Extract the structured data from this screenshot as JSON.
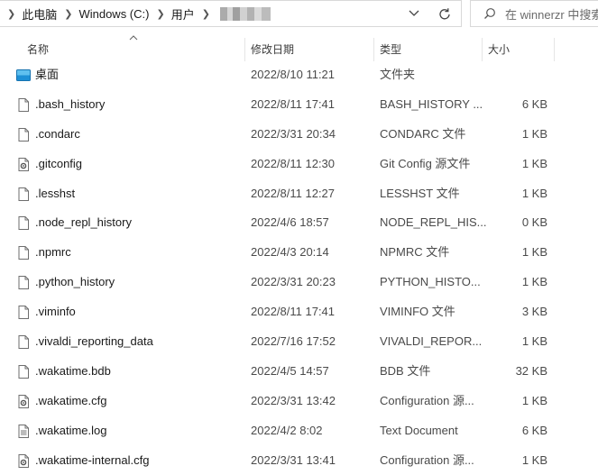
{
  "address": {
    "crumbs": [
      "此电脑",
      "Windows (C:)",
      "用户"
    ]
  },
  "search": {
    "placeholder": "在 winnerzr 中搜索"
  },
  "columns": {
    "name": "名称",
    "date": "修改日期",
    "type": "类型",
    "size": "大小"
  },
  "files": [
    {
      "name": "桌面",
      "date": "2022/8/10 11:21",
      "type": "文件夹",
      "size": "",
      "icon": "folder-desktop-icon"
    },
    {
      "name": ".bash_history",
      "date": "2022/8/11 17:41",
      "type": "BASH_HISTORY ...",
      "size": "6 KB",
      "icon": "file-icon"
    },
    {
      "name": ".condarc",
      "date": "2022/3/31 20:34",
      "type": "CONDARC 文件",
      "size": "1 KB",
      "icon": "file-icon"
    },
    {
      "name": ".gitconfig",
      "date": "2022/8/11 12:30",
      "type": "Git Config 源文件",
      "size": "1 KB",
      "icon": "config-file-icon"
    },
    {
      "name": ".lesshst",
      "date": "2022/8/11 12:27",
      "type": "LESSHST 文件",
      "size": "1 KB",
      "icon": "file-icon"
    },
    {
      "name": ".node_repl_history",
      "date": "2022/4/6 18:57",
      "type": "NODE_REPL_HIS...",
      "size": "0 KB",
      "icon": "file-icon"
    },
    {
      "name": ".npmrc",
      "date": "2022/4/3 20:14",
      "type": "NPMRC 文件",
      "size": "1 KB",
      "icon": "file-icon"
    },
    {
      "name": ".python_history",
      "date": "2022/3/31 20:23",
      "type": "PYTHON_HISTO...",
      "size": "1 KB",
      "icon": "file-icon"
    },
    {
      "name": ".viminfo",
      "date": "2022/8/11 17:41",
      "type": "VIMINFO 文件",
      "size": "3 KB",
      "icon": "file-icon"
    },
    {
      "name": ".vivaldi_reporting_data",
      "date": "2022/7/16 17:52",
      "type": "VIVALDI_REPOR...",
      "size": "1 KB",
      "icon": "file-icon"
    },
    {
      "name": ".wakatime.bdb",
      "date": "2022/4/5 14:57",
      "type": "BDB 文件",
      "size": "32 KB",
      "icon": "file-icon"
    },
    {
      "name": ".wakatime.cfg",
      "date": "2022/3/31 13:42",
      "type": "Configuration 源...",
      "size": "1 KB",
      "icon": "config-file-icon"
    },
    {
      "name": ".wakatime.log",
      "date": "2022/4/2 8:02",
      "type": "Text Document",
      "size": "6 KB",
      "icon": "text-file-icon"
    },
    {
      "name": ".wakatime-internal.cfg",
      "date": "2022/3/31 13:41",
      "type": "Configuration 源...",
      "size": "1 KB",
      "icon": "config-file-icon"
    }
  ]
}
